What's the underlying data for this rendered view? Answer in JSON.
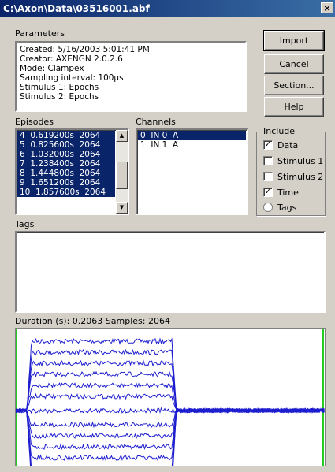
{
  "window": {
    "title": "C:\\Axon\\Data\\03516001.abf",
    "close_glyph": "×"
  },
  "parameters": {
    "label": "Parameters",
    "lines": [
      "Created: 5/16/2003 5:01:41 PM",
      "Creator: AXENGN 2.0.2.6",
      "Mode: Clampex",
      "Sampling interval: 100µs",
      "Stimulus 1: Epochs",
      "Stimulus 2: Epochs"
    ]
  },
  "buttons": {
    "import": "Import",
    "cancel": "Cancel",
    "section": "Section...",
    "help": "Help"
  },
  "episodes": {
    "label": "Episodes",
    "rows": [
      "4  0.619200s  2064",
      "5  0.825600s  2064",
      "6  1.032000s  2064",
      "7  1.238400s  2064",
      "8  1.444800s  2064",
      "9  1.651200s  2064",
      "10  1.857600s  2064"
    ]
  },
  "channels": {
    "label": "Channels",
    "rows": [
      "0  IN 0  A",
      "1  IN 1  A"
    ]
  },
  "include": {
    "label": "Include",
    "data": {
      "label": "Data",
      "checked": true
    },
    "stimulus1": {
      "label": "Stimulus 1",
      "checked": false
    },
    "stimulus2": {
      "label": "Stimulus 2",
      "checked": false
    },
    "time": {
      "label": "Time",
      "checked": true
    },
    "tags": {
      "label": "Tags",
      "selected": false
    },
    "check_glyph": "✓"
  },
  "tags": {
    "label": "Tags"
  },
  "info": {
    "text": "Duration (s): 0.2063   Samples: 2064"
  },
  "colors": {
    "trace": "#1e1ed0",
    "marker": "#22cc22",
    "selection": "#0a246a"
  }
}
